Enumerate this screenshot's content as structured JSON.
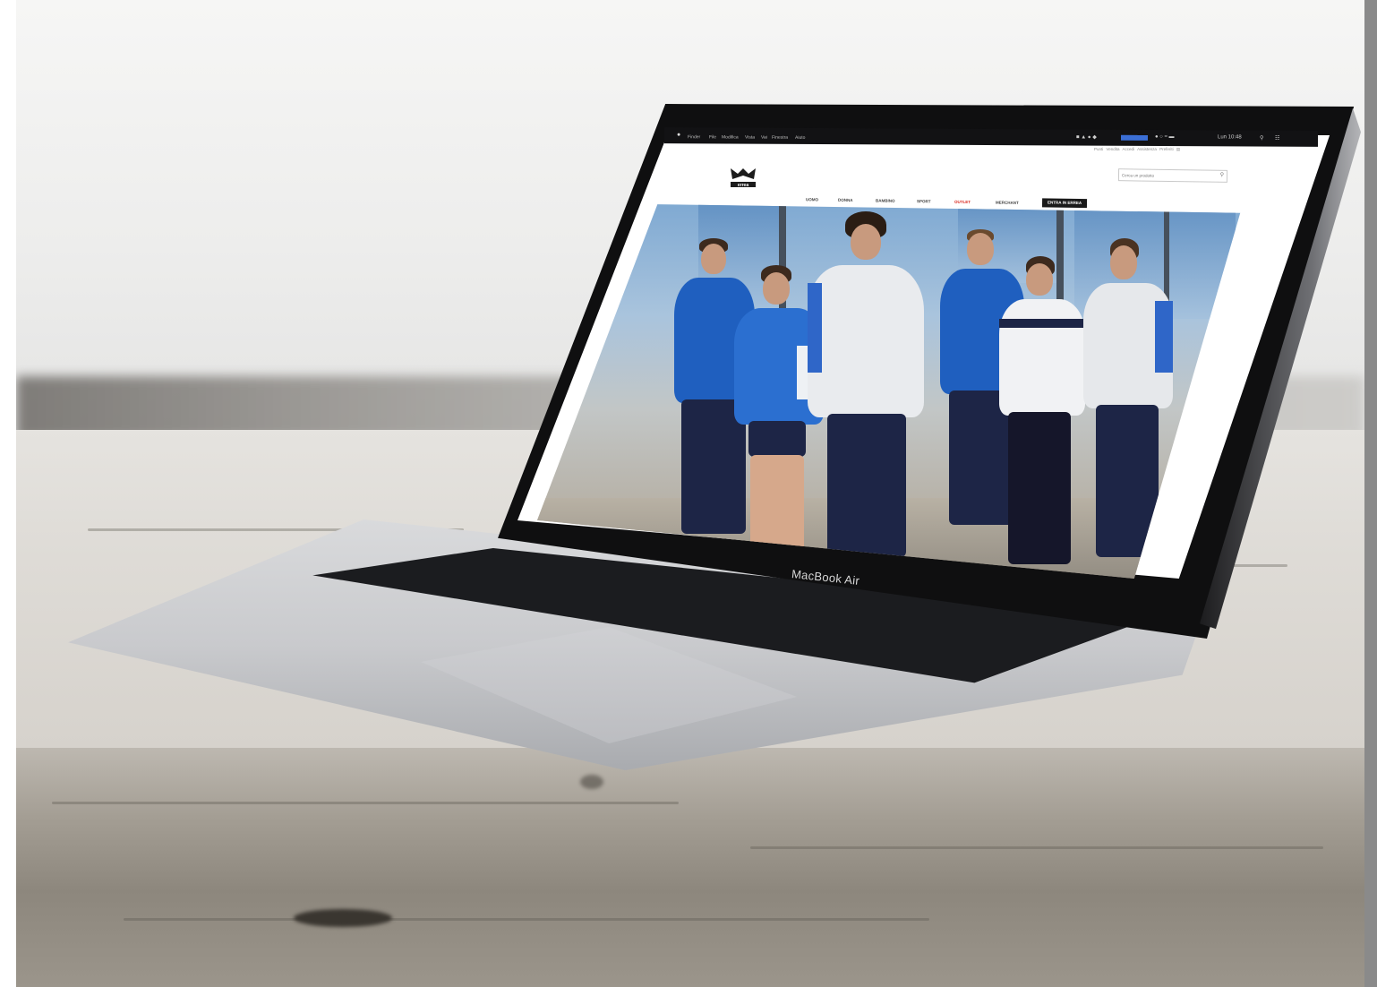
{
  "laptop": {
    "brand_label": "MacBook Air"
  },
  "menubar": {
    "items": [
      "Finder",
      "File",
      "Modifica",
      "Vista",
      "Vai",
      "Finestra",
      "Aiuto"
    ],
    "clock": "Lun 10:48"
  },
  "website": {
    "brand": "errea",
    "utility_links": [
      "Punti Vendita",
      "Accedi",
      "Assistenza",
      "Preferiti"
    ],
    "search": {
      "placeholder": "Cerca un prodotto"
    },
    "nav": {
      "items": [
        "UOMO",
        "DONNA",
        "BAMBINO",
        "SPORT",
        "OUTLET",
        "MERCHANT"
      ],
      "cta": "ENTRA IN ERREA"
    }
  },
  "colors": {
    "outlet_red": "#d9261c",
    "jersey_blue": "#1f5fbf",
    "navy": "#1d2546"
  }
}
